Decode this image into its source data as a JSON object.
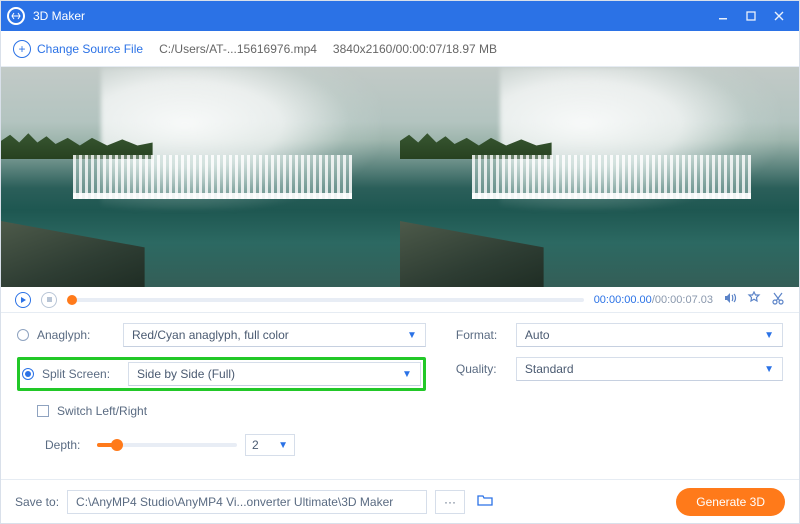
{
  "titlebar": {
    "title": "3D Maker"
  },
  "toolbar": {
    "change_source_label": "Change Source File",
    "file_path": "C:/Users/AT-...15616976.mp4",
    "file_info": "3840x2160/00:00:07/18.97 MB"
  },
  "player": {
    "time_current": "00:00:00.00",
    "time_total": "00:00:07.03"
  },
  "options": {
    "anaglyph": {
      "label": "Anaglyph:",
      "value": "Red/Cyan anaglyph, full color",
      "checked": false
    },
    "split_screen": {
      "label": "Split Screen:",
      "value": "Side by Side (Full)",
      "checked": true
    },
    "switch_lr": {
      "label": "Switch Left/Right",
      "checked": false
    },
    "depth": {
      "label": "Depth:",
      "value": "2"
    },
    "format": {
      "label": "Format:",
      "value": "Auto"
    },
    "quality": {
      "label": "Quality:",
      "value": "Standard"
    }
  },
  "footer": {
    "save_to_label": "Save to:",
    "save_path": "C:\\AnyMP4 Studio\\AnyMP4 Vi...onverter Ultimate\\3D Maker",
    "generate_label": "Generate 3D"
  }
}
